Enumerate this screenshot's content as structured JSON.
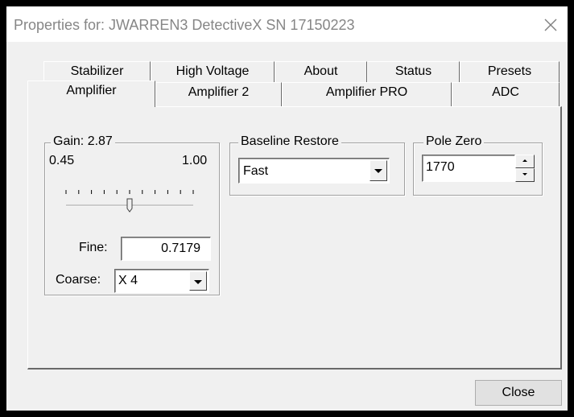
{
  "window": {
    "title": "Properties for: JWARREN3 DetectiveX SN 17150223"
  },
  "tabs": {
    "back_row": [
      {
        "label": "Stabilizer"
      },
      {
        "label": "High Voltage"
      },
      {
        "label": "About"
      },
      {
        "label": "Status"
      },
      {
        "label": "Presets"
      }
    ],
    "front_row": [
      {
        "label": "Amplifier",
        "selected": true
      },
      {
        "label": "Amplifier 2",
        "selected": false
      },
      {
        "label": "Amplifier PRO",
        "selected": false
      },
      {
        "label": "ADC",
        "selected": false
      }
    ]
  },
  "gain": {
    "legend": "Gain: 2.87",
    "min_label": "0.45",
    "max_label": "1.00",
    "slider_ticks": 11,
    "slider_level": 0.5,
    "fine_label": "Fine:",
    "fine_value": "0.7179",
    "coarse_label": "Coarse:",
    "coarse_value": "X 4"
  },
  "baseline_restore": {
    "legend": "Baseline Restore",
    "value": "Fast"
  },
  "pole_zero": {
    "legend": "Pole Zero",
    "value": "1770"
  },
  "footer": {
    "close_label": "Close"
  },
  "icons": {
    "close": "close-icon",
    "dropdown": "chevron-down-icon",
    "spin_up": "spin-up-icon",
    "spin_down": "spin-down-icon"
  }
}
